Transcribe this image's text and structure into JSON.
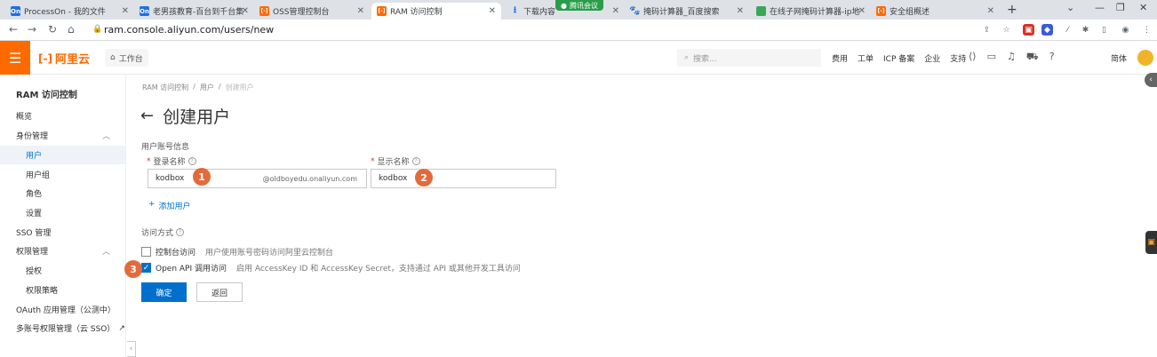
{
  "browser": {
    "tabs": [
      {
        "title": "ProcessOn - 我的文件",
        "icon": "On",
        "active": false
      },
      {
        "title": "老男孩教育-百台到千台集",
        "icon": "On",
        "active": false
      },
      {
        "title": "OSS管理控制台",
        "icon": "aliyun",
        "active": false
      },
      {
        "title": "RAM 访问控制",
        "icon": "aliyun",
        "active": true
      },
      {
        "title": "下载内容",
        "icon": "download",
        "active": false
      },
      {
        "title": "掩码计算器_百度搜索",
        "icon": "baidu",
        "active": false
      },
      {
        "title": "在线子网掩码计算器-ip地",
        "icon": "green",
        "active": false
      },
      {
        "title": "安全组概述",
        "icon": "aliyun",
        "active": false
      }
    ],
    "meeting_badge": "腾讯会议",
    "url": "ram.console.aliyun.com/users/new"
  },
  "topnav": {
    "brand": "阿里云",
    "brand_mark": "[-]",
    "workbench": "工作台",
    "search_placeholder": "搜索...",
    "links": [
      "费用",
      "工单",
      "ICP 备案",
      "企业",
      "支持"
    ],
    "lang": "简体"
  },
  "sidebar": {
    "title": "RAM 访问控制",
    "items": [
      {
        "label": "概览"
      },
      {
        "label": "身份管理"
      },
      {
        "label": "用户"
      },
      {
        "label": "用户组"
      },
      {
        "label": "角色"
      },
      {
        "label": "设置"
      },
      {
        "label": "SSO 管理"
      },
      {
        "label": "权限管理"
      },
      {
        "label": "授权"
      },
      {
        "label": "权限策略"
      },
      {
        "label": "OAuth 应用管理（公测中）"
      },
      {
        "label": "多账号权限管理（云 SSO）"
      }
    ]
  },
  "main": {
    "breadcrumb": [
      "RAM 访问控制",
      "用户",
      "创建用户"
    ],
    "title": "创建用户",
    "account_section": "用户账号信息",
    "login_name_label": "登录名称",
    "login_name_value": "kodbox",
    "login_name_suffix": "@oldboyedu.onaliyun.com",
    "display_name_label": "显示名称",
    "display_name_value": "kodbox",
    "add_user": "添加用户",
    "access_section": "访问方式",
    "console_access_label": "控制台访问",
    "console_access_desc": "用户使用账号密码访问阿里云控制台",
    "console_access_checked": false,
    "api_access_label": "Open API 调用访问",
    "api_access_desc": "启用 AccessKey ID 和 AccessKey Secret，支持通过 API 或其他开发工具访问",
    "api_access_checked": true,
    "confirm": "确定",
    "back": "返回"
  },
  "annotations": [
    "1",
    "2",
    "3"
  ],
  "colors": {
    "brand": "#ff6a00",
    "primary": "#0070cc",
    "badge": "#e26a3b"
  }
}
